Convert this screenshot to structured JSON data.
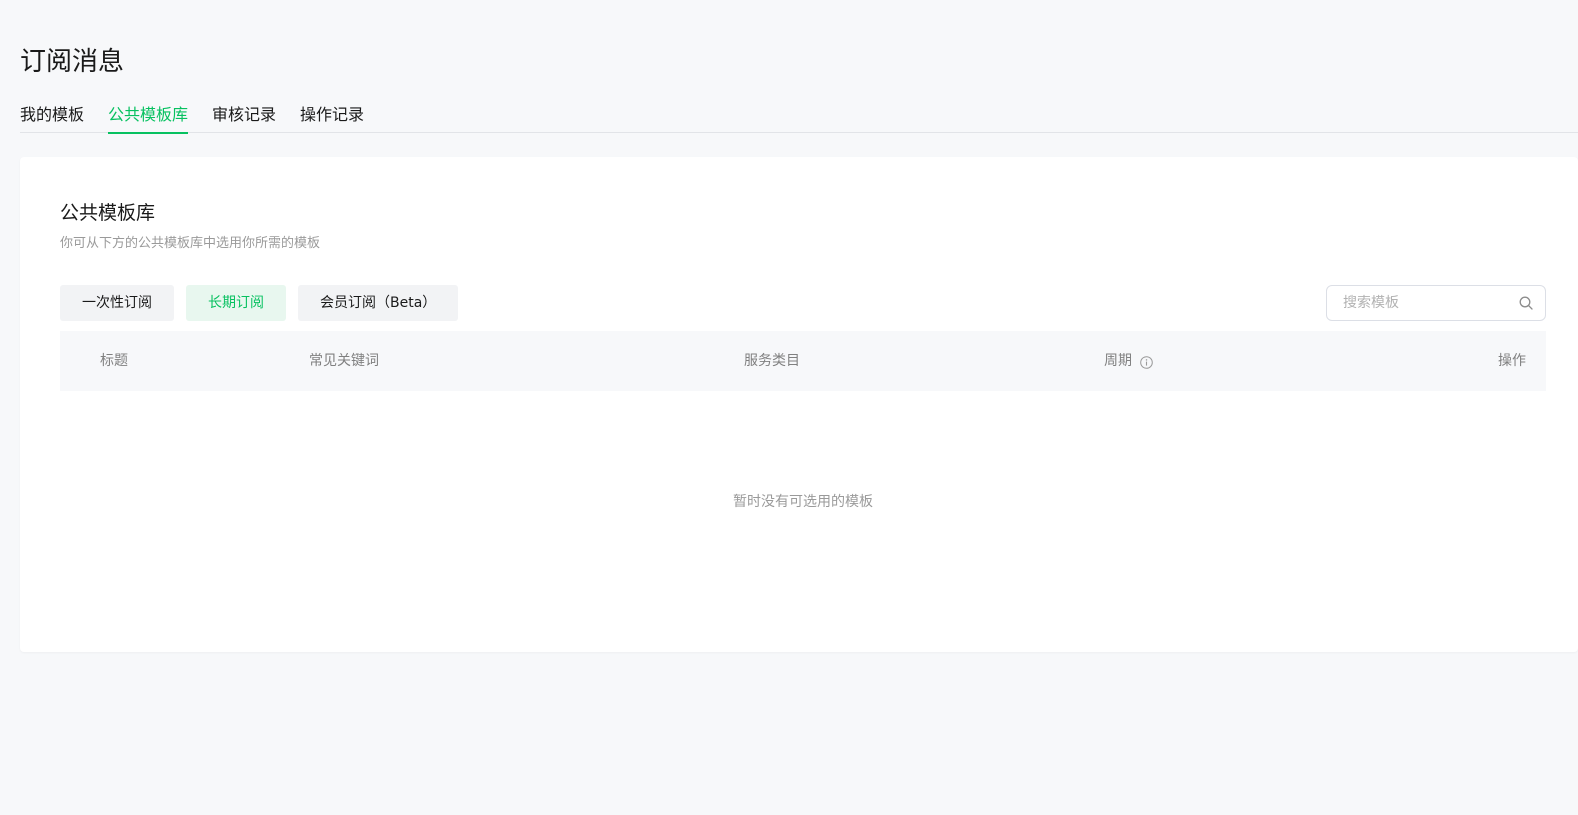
{
  "page": {
    "title": "订阅消息"
  },
  "tabs": [
    {
      "label": "我的模板",
      "active": false
    },
    {
      "label": "公共模板库",
      "active": true
    },
    {
      "label": "审核记录",
      "active": false
    },
    {
      "label": "操作记录",
      "active": false
    }
  ],
  "section": {
    "title": "公共模板库",
    "description": "你可从下方的公共模板库中选用你所需的模板"
  },
  "filters": [
    {
      "label": "一次性订阅",
      "active": false
    },
    {
      "label": "长期订阅",
      "active": true
    },
    {
      "label": "会员订阅（Beta）",
      "active": false
    }
  ],
  "search": {
    "placeholder": "搜索模板",
    "value": ""
  },
  "table": {
    "columns": {
      "title": "标题",
      "keywords": "常见关键词",
      "category": "服务类目",
      "period": "周期",
      "operation": "操作"
    },
    "empty_text": "暂时没有可选用的模板"
  },
  "colors": {
    "accent": "#07c160",
    "background": "#f7f8fa",
    "muted": "#9a9a9a"
  },
  "icons": {
    "search": "search-icon",
    "info": "info-icon"
  }
}
